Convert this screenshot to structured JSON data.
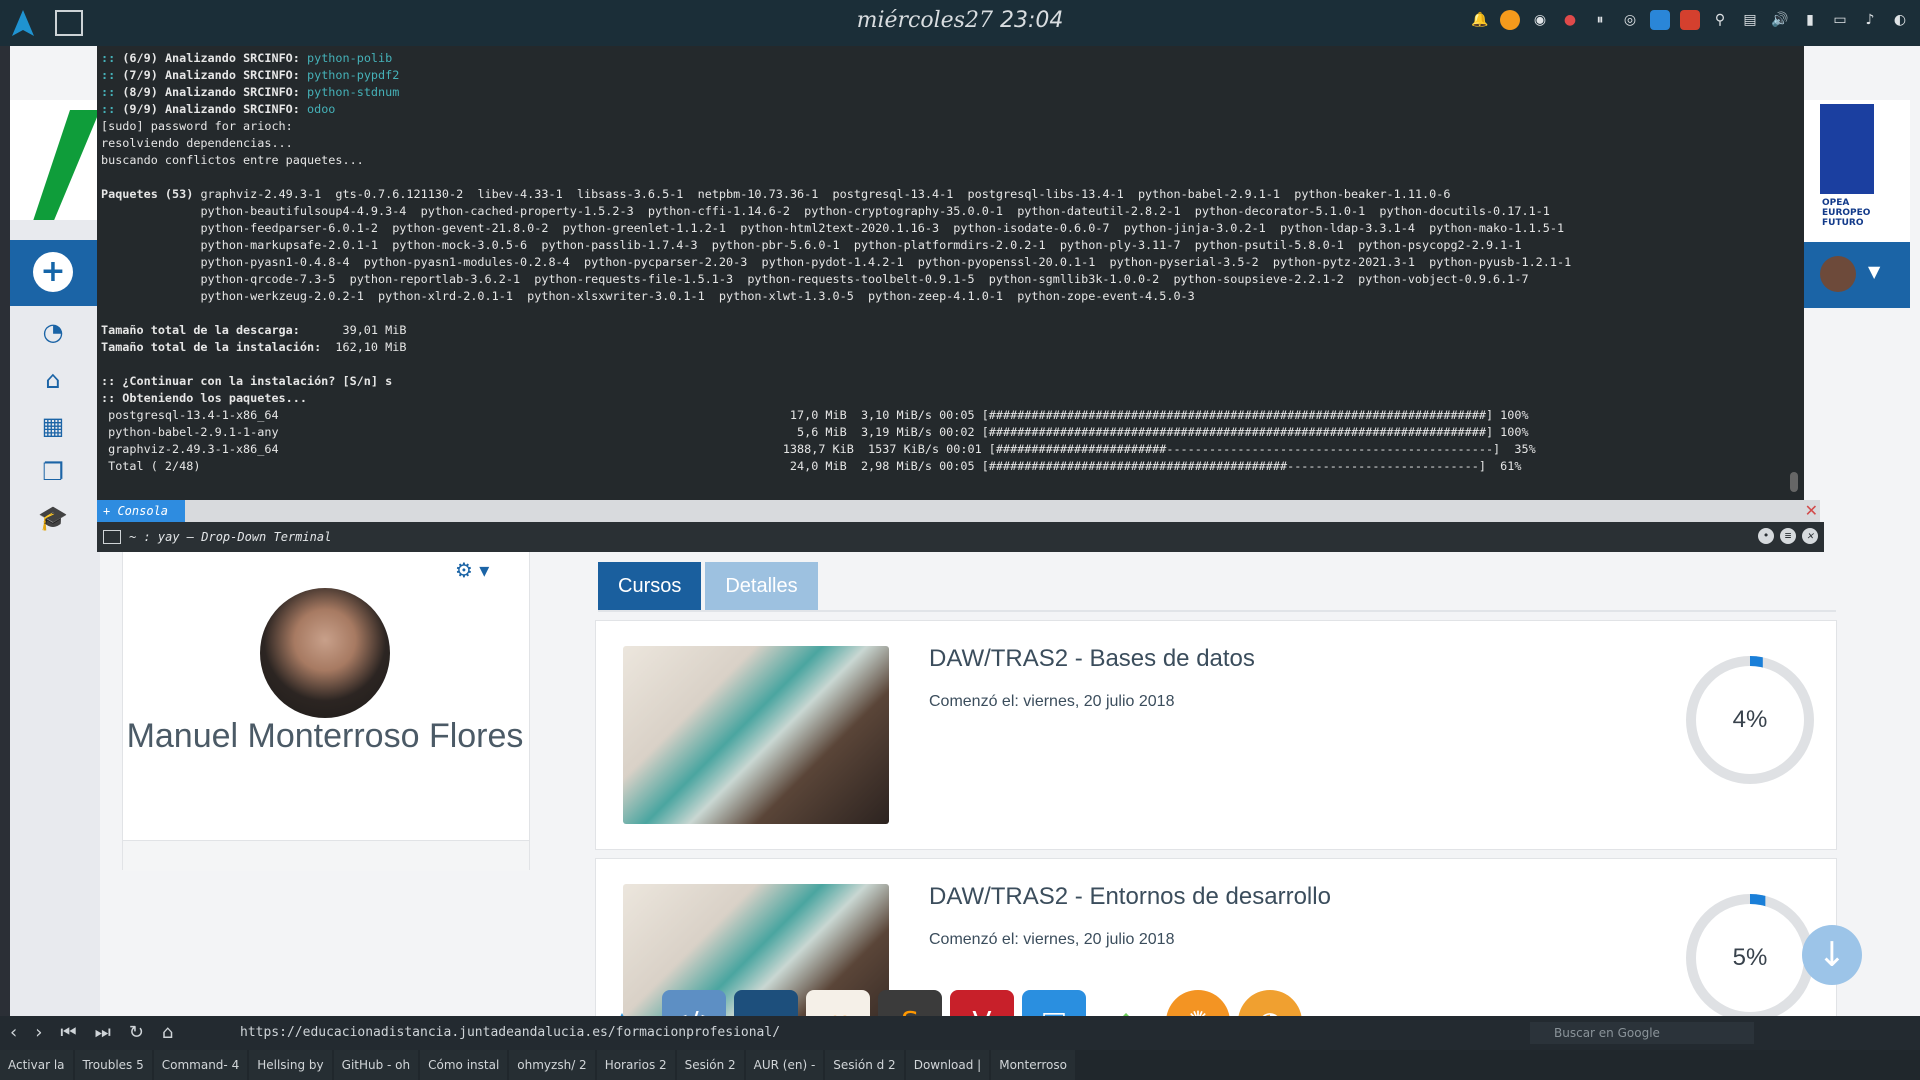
{
  "topbar": {
    "date": "miércoles27",
    "time": "23:04"
  },
  "terminal": {
    "lines": [
      {
        "pre": ":: ",
        "text": "(6/9) Analizando SRCINFO: ",
        "pkg": "python-polib"
      },
      {
        "pre": ":: ",
        "text": "(7/9) Analizando SRCINFO: ",
        "pkg": "python-pypdf2"
      },
      {
        "pre": ":: ",
        "text": "(8/9) Analizando SRCINFO: ",
        "pkg": "python-stdnum"
      },
      {
        "pre": ":: ",
        "text": "(9/9) Analizando SRCINFO: ",
        "pkg": "odoo"
      }
    ],
    "plain1": "[sudo] password for arioch:",
    "plain2": "resolviendo dependencias...",
    "plain3": "buscando conflictos entre paquetes...",
    "packages_label": "Paquetes (53)",
    "packages_rows": [
      "graphviz-2.49.3-1  gts-0.7.6.121130-2  libev-4.33-1  libsass-3.6.5-1  netpbm-10.73.36-1  postgresql-13.4-1  postgresql-libs-13.4-1  python-babel-2.9.1-1  python-beaker-1.11.0-6",
      "python-beautifulsoup4-4.9.3-4  python-cached-property-1.5.2-3  python-cffi-1.14.6-2  python-cryptography-35.0.0-1  python-dateutil-2.8.2-1  python-decorator-5.1.0-1  python-docutils-0.17.1-1",
      "python-feedparser-6.0.1-2  python-gevent-21.8.0-2  python-greenlet-1.1.2-1  python-html2text-2020.1.16-3  python-isodate-0.6.0-7  python-jinja-3.0.2-1  python-ldap-3.3.1-4  python-mako-1.1.5-1",
      "python-markupsafe-2.0.1-1  python-mock-3.0.5-6  python-passlib-1.7.4-3  python-pbr-5.6.0-1  python-platformdirs-2.0.2-1  python-ply-3.11-7  python-psutil-5.8.0-1  python-psycopg2-2.9.1-1",
      "python-pyasn1-0.4.8-4  python-pyasn1-modules-0.2.8-4  python-pycparser-2.20-3  python-pydot-1.4.2-1  python-pyopenssl-20.0.1-1  python-pyserial-3.5-2  python-pytz-2021.3-1  python-pyusb-1.2.1-1",
      "python-qrcode-7.3-5  python-reportlab-3.6.2-1  python-requests-file-1.5.1-3  python-requests-toolbelt-0.9.1-5  python-sgmllib3k-1.0.0-2  python-soupsieve-2.2.1-2  python-vobject-0.9.6.1-7",
      "python-werkzeug-2.0.2-1  python-xlrd-2.0.1-1  python-xlsxwriter-3.0.1-1  python-xlwt-1.3.0-5  python-zeep-4.1.0-1  python-zope-event-4.5.0-3"
    ],
    "download_label": "Tamaño total de la descarga:",
    "download_value": "39,01 MiB",
    "install_label": "Tamaño total de la instalación:",
    "install_value": "162,10 MiB",
    "prompt": ":: ¿Continuar con la instalación? [S/n] s",
    "fetching": ":: Obteniendo los paquetes...",
    "progress": [
      " postgresql-13.4-1-x86_64                                                                        17,0 MiB  3,10 MiB/s 00:05 [######################################################################] 100%",
      " python-babel-2.9.1-1-any                                                                         5,6 MiB  3,19 MiB/s 00:02 [######################################################################] 100%",
      " graphviz-2.49.3-1-x86_64                                                                       1388,7 KiB  1537 KiB/s 00:01 [########################----------------------------------------------]  35%",
      " Total ( 2/48)                                                                                   24,0 MiB  2,98 MiB/s 00:05 [##########################################---------------------------]  61%"
    ],
    "tab_label": "Consola",
    "window_title": "~ : yay – Drop-Down Terminal"
  },
  "eu_text": "OPEA EUROPEO FUTURO",
  "profile": {
    "name": "Manuel Monterroso Flores"
  },
  "tabs": [
    {
      "label": "Cursos"
    },
    {
      "label": "Detalles"
    }
  ],
  "courses": [
    {
      "title": "DAW/TRAS2 - Bases de datos",
      "date": "Comenzó el: viernes, 20 julio 2018",
      "progress": "4%"
    },
    {
      "title": "DAW/TRAS2 - Entornos de desarrollo",
      "date": "Comenzó el: viernes, 20 julio 2018",
      "progress": "5%"
    }
  ],
  "address_bar": {
    "url": "https://educacionadistancia.juntadeandalucia.es/formacionprofesional/",
    "search_placeholder": "Buscar en Google"
  },
  "taskbar": [
    "Activar la",
    "Troubles 5",
    "Command- 4",
    "Hellsing by",
    "GitHub - oh",
    "Cómo instal",
    "ohmyzsh/ 2",
    "Horarios 2",
    "Sesión 2",
    "AUR (en) -",
    "Sesión d 2",
    "Download |",
    "Monterroso"
  ],
  "colors": {
    "primary": "#1b64a6",
    "terminal_bg": "#24292c",
    "pkg_cyan": "#45b1b8"
  }
}
